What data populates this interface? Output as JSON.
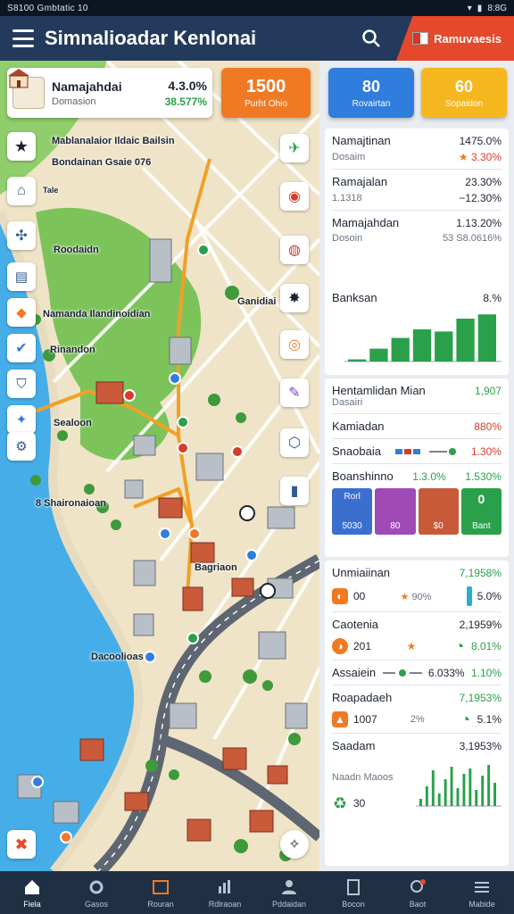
{
  "status_bar": {
    "left_text": "S8100 Gmbtatic 10",
    "time": "8:8G"
  },
  "header": {
    "title": "Simnalioadar Kenlonai",
    "resources_label": "Ramuvaesis"
  },
  "city_card": {
    "name": "Namajahdai",
    "sub": "Domasion",
    "value1": "4.3.0%",
    "value2": "38.577%"
  },
  "orange_card": {
    "big": "1500",
    "small": "Purht Ohio"
  },
  "map_labels": {
    "l1": "Mablanalaior Ildaic Bailsin",
    "l2": "Bondainan Gsaie 076",
    "l3": "Roodaidn",
    "l4": "Namanda Ilandinoidian",
    "l5": "Rinandon",
    "l6": "Sealoon",
    "l7": "Ganidiai",
    "l8": "8 Shaironaioan",
    "l9": "Bagriaon",
    "l10": "Dacoolioas",
    "l11": "Tale"
  },
  "panel": {
    "btn_left": {
      "big": "80",
      "small": "Rovairtan"
    },
    "btn_right": {
      "big": "60",
      "small": "Sopaidon"
    },
    "stat1": {
      "label": "Namajtinan",
      "value": "1475.0%",
      "sub": "Dosaim",
      "value2": "3.30%"
    },
    "stat2": {
      "label": "Ramajalan",
      "value": "23.30%",
      "sub": "1.1318",
      "value2": "−12.30%"
    },
    "stat3": {
      "label": "Mamajahdan",
      "value": "1.13.20%",
      "sub": "Dosoin",
      "value2": "53 S8.0616%"
    },
    "chart_card": {
      "label": "Banksan",
      "value": "8.%"
    },
    "stat4": {
      "label": "Hentamlidan Mian",
      "value": "1,907",
      "sub": "Dasairi"
    },
    "stat5": {
      "label": "Kamiadan",
      "value": "880%"
    },
    "stat6": {
      "label": "Snaobaia",
      "value": "1.30%"
    },
    "stat7": {
      "label": "Boanshinno",
      "value": "1.3.0%",
      "value2": "1.530%"
    },
    "tiles": [
      {
        "top": "Rorl",
        "bottom": "5030",
        "color": "#3a6fd0"
      },
      {
        "top": "",
        "bottom": "80",
        "color": "#a04ab8"
      },
      {
        "top": "",
        "bottom": "$0",
        "color": "#c85a3a"
      },
      {
        "top": "0",
        "bottom": "Bant",
        "color": "#2aa04a"
      }
    ],
    "u1": {
      "label": "Unmiaiinan",
      "value": "7,1958%",
      "left": "00",
      "mid": "90%",
      "right": "5.0%"
    },
    "u2": {
      "label": "Caotenia",
      "value": "2,1959%",
      "left": "201",
      "right": "8.01%"
    },
    "u3": {
      "label": "Assaiein",
      "mid": "6.033%",
      "value": "1.10%"
    },
    "u4": {
      "label": "Roapadaeh",
      "value": "7,1953%",
      "left": "1007",
      "mid": "2%",
      "right": "5.1%"
    },
    "u5": {
      "label": "Saadam",
      "value": "3,1953%",
      "sub": "Naadn Maoos",
      "left": "30"
    }
  },
  "chart_data": [
    {
      "type": "bar",
      "title": "Banksan",
      "categories": [
        "1",
        "2",
        "3",
        "4",
        "5",
        "6",
        "7"
      ],
      "values": [
        2,
        12,
        22,
        30,
        28,
        40,
        44
      ],
      "ylim": [
        0,
        50
      ]
    },
    {
      "type": "bar",
      "title": "Saadam",
      "categories": [
        "1",
        "2",
        "3",
        "4",
        "5",
        "6",
        "7",
        "8",
        "9",
        "10",
        "11",
        "12",
        "13"
      ],
      "values": [
        8,
        22,
        40,
        14,
        30,
        44,
        20,
        36,
        42,
        18,
        34,
        46,
        26
      ],
      "ylim": [
        0,
        50
      ]
    }
  ],
  "nav": [
    {
      "label": "Fiela",
      "icon": "home-icon"
    },
    {
      "label": "Gasos",
      "icon": "gear-icon"
    },
    {
      "label": "Rouran",
      "icon": "build-icon"
    },
    {
      "label": "Rdlraoan",
      "icon": "chart-icon"
    },
    {
      "label": "Pddaidan",
      "icon": "person-icon"
    },
    {
      "label": "Bocon",
      "icon": "doc-icon"
    },
    {
      "label": "Baot",
      "icon": "search-icon"
    },
    {
      "label": "Mabide",
      "icon": "menu-icon"
    }
  ],
  "colors": {
    "accent": "#233a5c",
    "green": "#2aa04a",
    "orange": "#f07a24",
    "red": "#e5482a"
  }
}
